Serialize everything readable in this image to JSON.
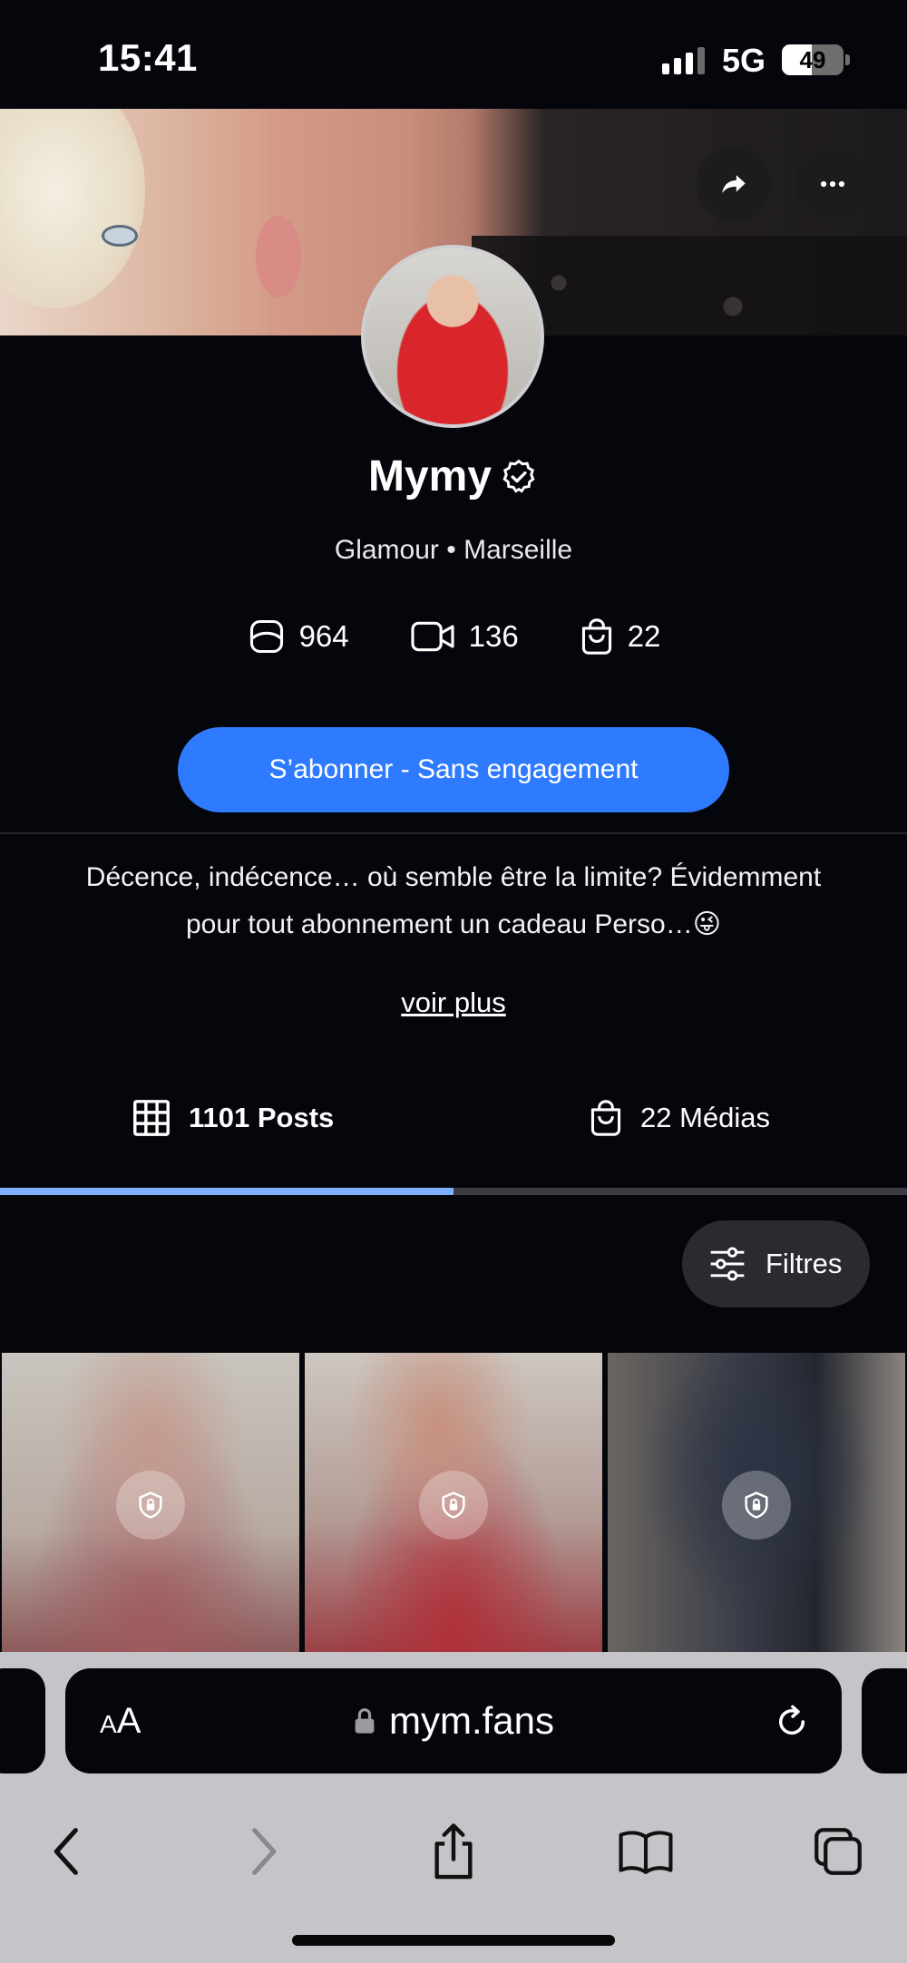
{
  "status_bar": {
    "time": "15:41",
    "network": "5G",
    "battery": "49",
    "battery_level": 0.49
  },
  "profile": {
    "name": "Mymy",
    "subtitle": "Glamour • Marseille",
    "stats": {
      "photos": "964",
      "videos": "136",
      "products": "22"
    },
    "subscribe_label": "S’abonner - Sans engagement",
    "bio_line1": "Décence, indécence… où semble être la limite? Évidemment",
    "bio_line2": "pour tout abonnement un cadeau Perso…😜",
    "see_more": "voir plus"
  },
  "tabs": {
    "posts_label": "1101 Posts",
    "medias_label": "22 Médias",
    "active": "posts"
  },
  "filters_label": "Filtres",
  "browser": {
    "aa_small": "A",
    "aa_large": "A",
    "url": "mym.fans"
  },
  "colors": {
    "background": "#05060b",
    "accent": "#2e7bff",
    "tab_indicator": "#7fb0ff",
    "browser_chrome": "#c5c5c9"
  }
}
